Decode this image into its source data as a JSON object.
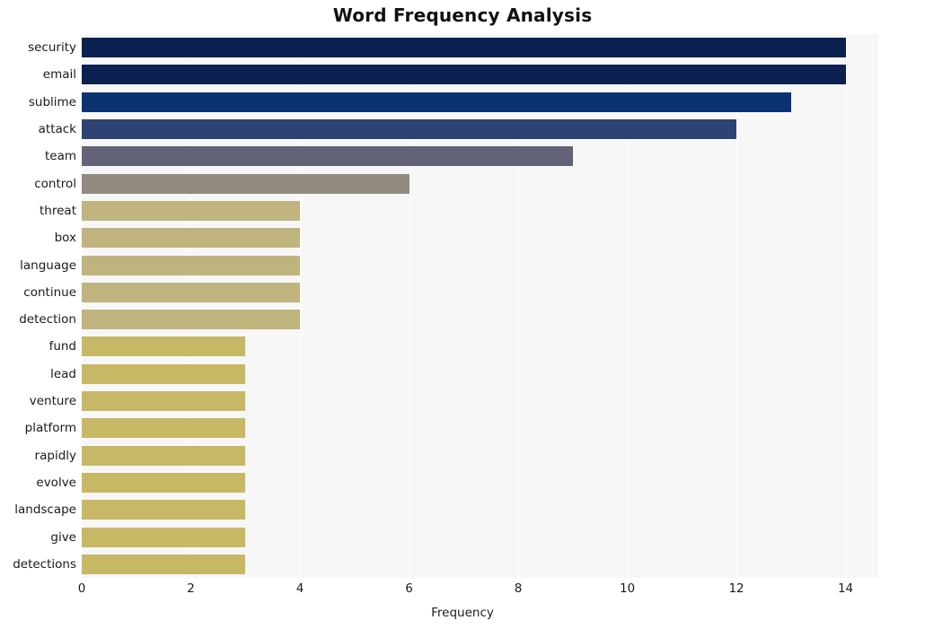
{
  "chart_data": {
    "type": "bar",
    "orientation": "horizontal",
    "title": "Word Frequency Analysis",
    "xlabel": "Frequency",
    "ylabel": "",
    "xlim": [
      0,
      14.6
    ],
    "xticks": [
      0,
      2,
      4,
      6,
      8,
      10,
      12,
      14
    ],
    "grid": true,
    "legend": null,
    "categories": [
      "security",
      "email",
      "sublime",
      "attack",
      "team",
      "control",
      "threat",
      "box",
      "language",
      "continue",
      "detection",
      "fund",
      "lead",
      "venture",
      "platform",
      "rapidly",
      "evolve",
      "landscape",
      "give",
      "detections"
    ],
    "values": [
      14,
      14,
      13,
      12,
      9,
      6,
      4,
      4,
      4,
      4,
      4,
      3,
      3,
      3,
      3,
      3,
      3,
      3,
      3,
      3
    ],
    "bar_colors": [
      "#0a2050",
      "#0a2050",
      "#0b3372",
      "#2f4274",
      "#636377",
      "#918b80",
      "#bfb47d",
      "#bfb47d",
      "#bfb47d",
      "#bfb47d",
      "#bfb47d",
      "#c6b865",
      "#c6b865",
      "#c6b865",
      "#c6b865",
      "#c6b865",
      "#c6b865",
      "#c6b865",
      "#c6b865",
      "#c6b865"
    ],
    "plot_background": "#f7f7f7",
    "gridline_color": "#ffffff",
    "figure_background": "#ffffff"
  }
}
